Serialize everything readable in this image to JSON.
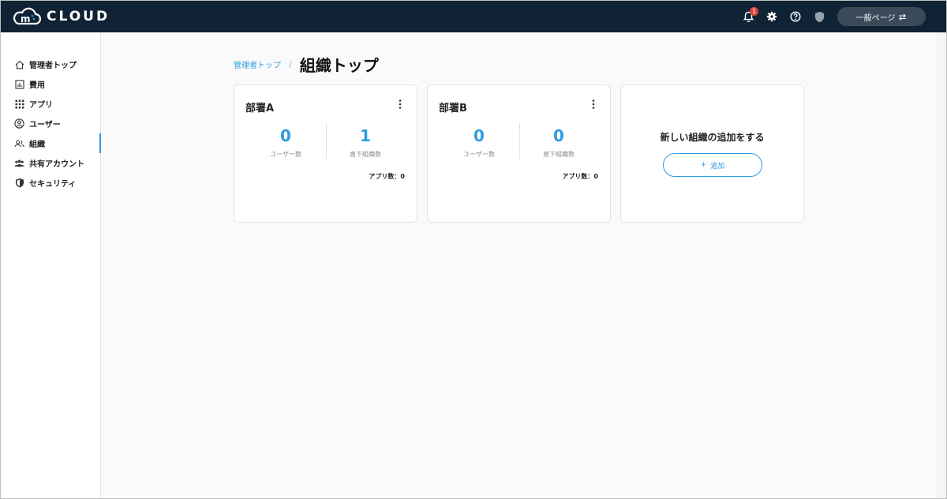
{
  "header": {
    "logo_text": "CLOUD",
    "notification_count": "1",
    "general_page_label": "一般ページ"
  },
  "sidebar": {
    "items": [
      {
        "label": "管理者トップ",
        "icon": "home-icon"
      },
      {
        "label": "費用",
        "icon": "chart-icon"
      },
      {
        "label": "アプリ",
        "icon": "grid-icon"
      },
      {
        "label": "ユーザー",
        "icon": "user-circle-icon"
      },
      {
        "label": "組織",
        "icon": "group-icon",
        "active": true
      },
      {
        "label": "共有アカウント",
        "icon": "shared-account-icon"
      },
      {
        "label": "セキュリティ",
        "icon": "shield-icon"
      }
    ]
  },
  "breadcrumb": {
    "parent": "管理者トップ",
    "separator": "/",
    "current": "組織トップ"
  },
  "cards": [
    {
      "name": "部署A",
      "user_count": "0",
      "user_count_label": "ユーザー数",
      "sub_org_count": "1",
      "sub_org_label": "直下組織数",
      "app_count_text": "アプリ数：0"
    },
    {
      "name": "部署B",
      "user_count": "0",
      "user_count_label": "ユーザー数",
      "sub_org_count": "0",
      "sub_org_label": "直下組織数",
      "app_count_text": "アプリ数：0"
    }
  ],
  "add_card": {
    "title": "新しい組織の追加をする",
    "button_label": "追加"
  },
  "colors": {
    "header_bg": "#0f2335",
    "accent": "#2f9be0",
    "badge": "#e0463d"
  }
}
